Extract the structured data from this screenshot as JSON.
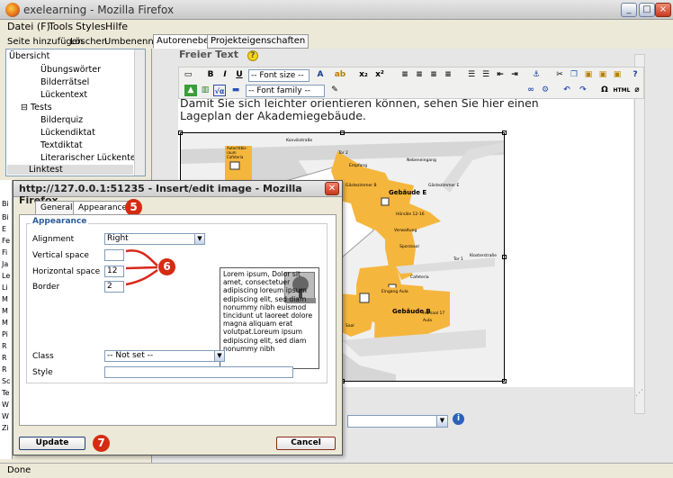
{
  "window": {
    "title": "exelearning - Mozilla Firefox",
    "min": "_",
    "max": "□",
    "close": "×"
  },
  "menu": [
    "Datei (F)",
    "Tools",
    "Styles",
    "Hilfe"
  ],
  "left_buttons": [
    "Seite hinzufügen",
    "Löschen",
    "Umbenennen"
  ],
  "tree": [
    "Übersicht",
    "Übungswörter",
    "Bilderrätsel",
    "Lückentext",
    "Tests",
    "Bilderquiz",
    "Lückendiktat",
    "Textdiktat",
    "Literarischer Lückentext",
    "Linktest"
  ],
  "tabs": [
    "Autorenebene",
    "Projekteigenschaften"
  ],
  "editor": {
    "idevice_title": "Freier Text",
    "font_size": "-- Font size --",
    "font_family": "-- Font family --",
    "paragraph": "Damit Sie sich leichter orientieren können, sehen Sie hier einen Lageplan der Akademiegebäude.",
    "toolbar_bold": "B",
    "toolbar_italic": "I",
    "toolbar_underline": "U",
    "toolbar_sub": "x₂",
    "toolbar_sup": "x²",
    "toolbar_omega": "Ω",
    "toolbar_html": "HTML"
  },
  "map_labels": [
    "Konvikstraße",
    "Tor 2",
    "Empfang",
    "Gebäude E",
    "Gebäude B",
    "Nebeneingang",
    "Gästezimmer B",
    "Gästezimmer E",
    "Verwaltung",
    "Hörsäle 12-16",
    "Sporzsaal",
    "Tor 1",
    "Klosterstraße",
    "Cafeteria",
    "Eingang Aula",
    "Hörsaal 17",
    "Aula",
    "Saal",
    "Autochtbis-raum Cafeteria"
  ],
  "dialog": {
    "title": "http://127.0.0.1:51235 - Insert/edit image - Mozilla Firefox",
    "tabs": [
      "General",
      "Appearance"
    ],
    "legend": "Appearance",
    "alignment_label": "Alignment",
    "alignment_value": "Right",
    "vspace_label": "Vertical space",
    "vspace_value": "",
    "hspace_label": "Horizontal space",
    "hspace_value": "12",
    "border_label": "Border",
    "border_value": "2",
    "class_label": "Class",
    "class_value": "-- Not set --",
    "style_label": "Style",
    "style_value": "",
    "preview_text": "Lorem ipsum, Dolor sit amet, consectetuer adipiscing loreum ipsum edipiscing elit, sed diam nonummy nibh euismod tincidunt ut laoreet dolore magna aliquam erat volutpat.Loreum ipsum edipiscing elit, sed diam nonummy nibh",
    "update": "Update",
    "cancel": "Cancel"
  },
  "badges": [
    "5",
    "6",
    "7"
  ],
  "left_list_initials": [
    "Bi",
    "Bi",
    "E",
    "Fe",
    "Fi",
    "Ja",
    "Le",
    "Li",
    "M",
    "M",
    "M",
    "Pi",
    "R",
    "R",
    "R",
    "Sc",
    "Te",
    "W",
    "W",
    "Zi"
  ],
  "status": "Done",
  "colors": {
    "accent_orange": "#f5b63d",
    "badge_red": "#d62b12",
    "arrow_red": "#d8281a",
    "legend_blue": "#2d5b9a"
  }
}
